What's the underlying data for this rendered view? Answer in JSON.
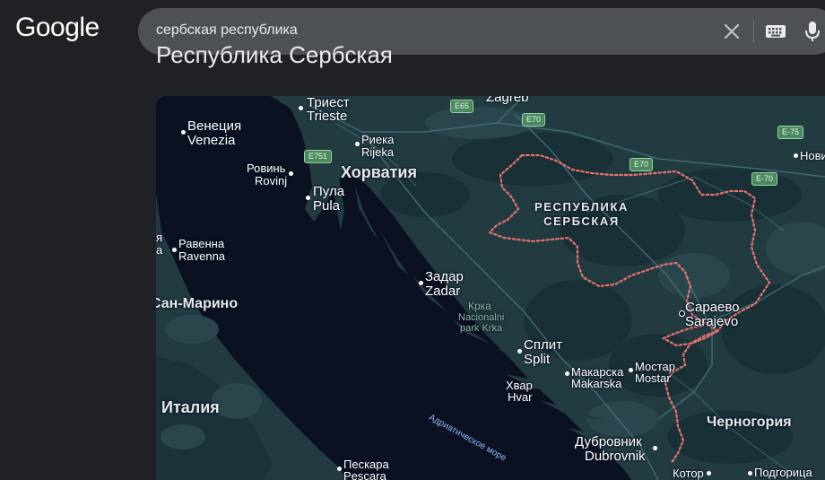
{
  "header": {
    "logo": "Google",
    "search_query": "сербская республика",
    "icons": {
      "clear": "close-icon",
      "keyboard": "keyboard-icon",
      "voice": "microphone-icon"
    }
  },
  "section": {
    "heading": "Республика Сербская"
  },
  "map": {
    "countries": {
      "croatia": "Хорватия",
      "italy": "Италия",
      "montenegro": "Черногория",
      "san_marino": "Сан-Марино"
    },
    "region": {
      "line1": "РЕСПУБЛИКА",
      "line2": "СЕРБСКАЯ"
    },
    "cities": {
      "trieste_ru": "Триест",
      "trieste_en": "Trieste",
      "zagreb": "Zagreb",
      "venezia_ru": "Венеция",
      "venezia_en": "Venezia",
      "rijeka_ru": "Риека",
      "rijeka_en": "Rijeka",
      "rovinj_ru": "Ровинь",
      "rovinj_en": "Rovinj",
      "pula_ru": "Пула",
      "pula_en": "Pula",
      "ravenna_ru": "Равенна",
      "ravenna_en": "Ravenna",
      "zadar_ru": "Задар",
      "zadar_en": "Zadar",
      "split_ru": "Сплит",
      "split_en": "Split",
      "hvar_ru": "Хвар",
      "hvar_en": "Hvar",
      "makarska_ru": "Макарска",
      "makarska_en": "Makarska",
      "mostar_ru": "Мостар",
      "mostar_en": "Mostar",
      "sarajevo_ru": "Сараево",
      "sarajevo_en": "Sarajevo",
      "dubrovnik_ru": "Дубровник",
      "dubrovnik_en": "Dubrovnik",
      "kotor": "Котор",
      "podgorica": "Подгорица",
      "pescara_ru": "Пескара",
      "pescara_en": "Pescara",
      "novi_partial": "Нови",
      "left_partial_1": "я",
      "left_partial_2": "а"
    },
    "park": {
      "name_ru": "Крка",
      "name_en_1": "Nacionalni",
      "name_en_2": "park Krka"
    },
    "sea": "Адриатическое море",
    "routes": {
      "e65": "E65",
      "e70_a": "E70",
      "e70_b": "E70",
      "e70_c": "E-70",
      "e75": "E-75",
      "e751": "E751"
    },
    "colors": {
      "sea": "#0b1121",
      "land": "#223b41",
      "land_dark": "#193037",
      "border": "#e8726e"
    }
  }
}
